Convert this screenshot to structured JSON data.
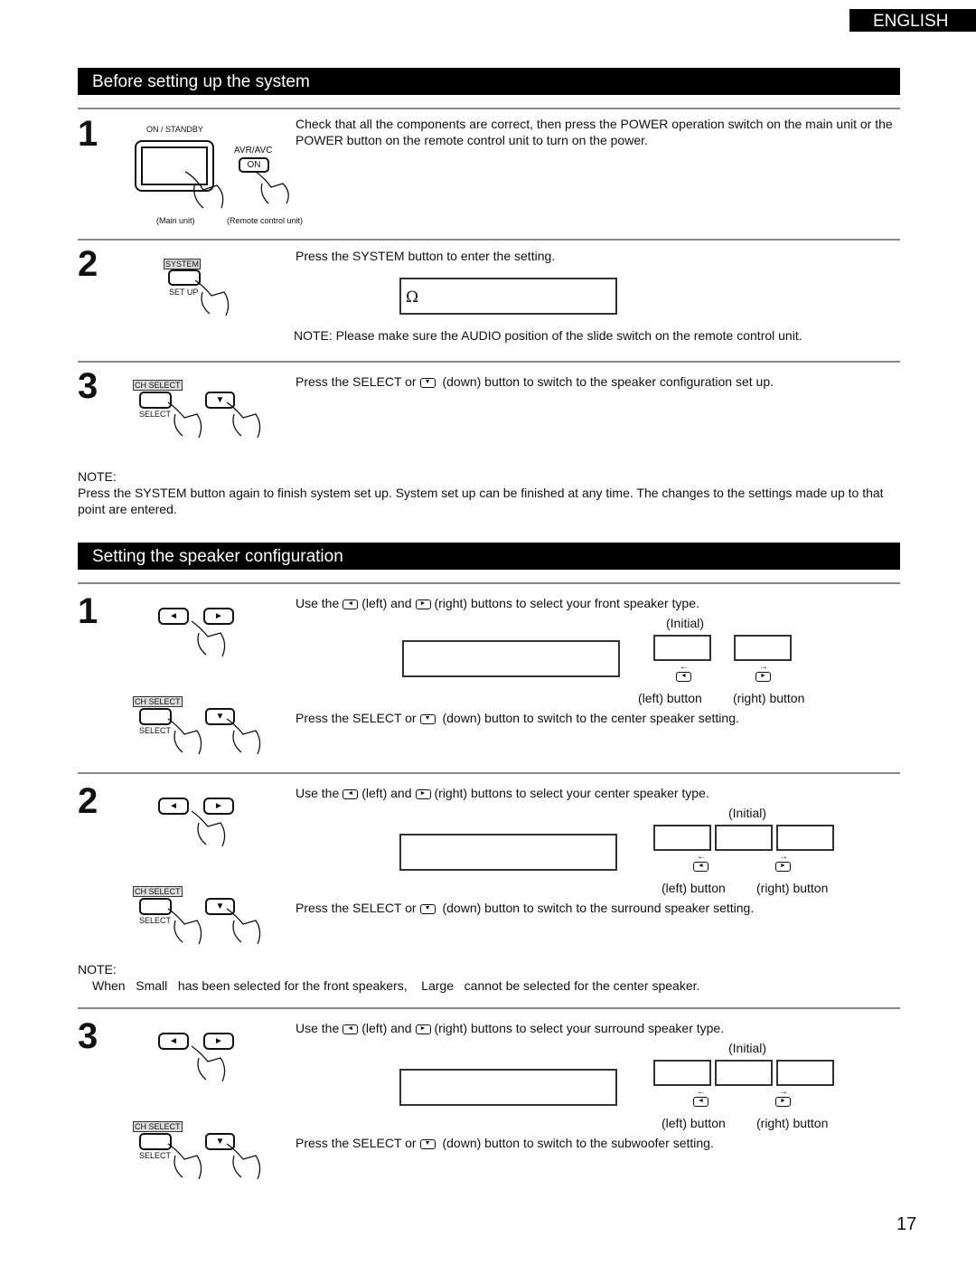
{
  "header": {
    "language": "ENGLISH"
  },
  "section1": {
    "title": "Before setting up the system",
    "steps": [
      {
        "number": "1",
        "labels": {
          "main_button": "ON / STANDBY",
          "remote_button_label": "AVR/AVC",
          "remote_button_text": "ON",
          "main_caption": "(Main unit)",
          "remote_caption": "(Remote control unit)"
        },
        "text": "Check that all the components are correct, then press the POWER operation switch on the main unit or the POWER button on the remote control unit to turn on the power."
      },
      {
        "number": "2",
        "labels": {
          "top": "SYSTEM",
          "bottom": "SET UP"
        },
        "text": "Press the SYSTEM button to enter the setting.",
        "display": "Ω",
        "note": "NOTE:  Please make sure the   AUDIO   position of the slide switch on the remote control unit."
      },
      {
        "number": "3",
        "labels": {
          "top": "CH SELECT",
          "bottom": "SELECT"
        },
        "text_before": "Press the SELECT or",
        "text_after": "(down) button to switch to the speaker configuration set up."
      }
    ],
    "note_heading": "NOTE:",
    "note_text": "Press the SYSTEM button again to finish system set up.  System set up can be finished at any time.  The changes to the settings  made up to that point are entered."
  },
  "section2": {
    "title": "Setting the speaker configuration",
    "common": {
      "use_the": "Use the",
      "left_and": "(left) and",
      "initial": "(Initial)",
      "left_button": "(left) button",
      "right_button": "(right) button",
      "press_select": "Press the SELECT or",
      "ch_select": "CH SELECT",
      "select": "SELECT"
    },
    "steps": [
      {
        "number": "1",
        "right_text": "(right) buttons to select your front speaker type.",
        "down_text": "(down) button to switch to the center speaker setting."
      },
      {
        "number": "2",
        "right_text": "(right) buttons to select your center speaker type.",
        "down_text": "(down) button to switch to the surround speaker setting."
      },
      {
        "number": "3",
        "right_text": "(right) buttons to select your surround speaker type.",
        "down_text": "(down) button to switch to the subwoofer setting."
      }
    ],
    "note_heading": "NOTE:",
    "note_text": "When   Small   has been selected for the front speakers,    Large   cannot be selected for the center speaker."
  },
  "icons": {
    "left": "◄",
    "right": "►",
    "down": "▼",
    "arrow_left": "←",
    "arrow_right": "→"
  },
  "page_number": "17"
}
